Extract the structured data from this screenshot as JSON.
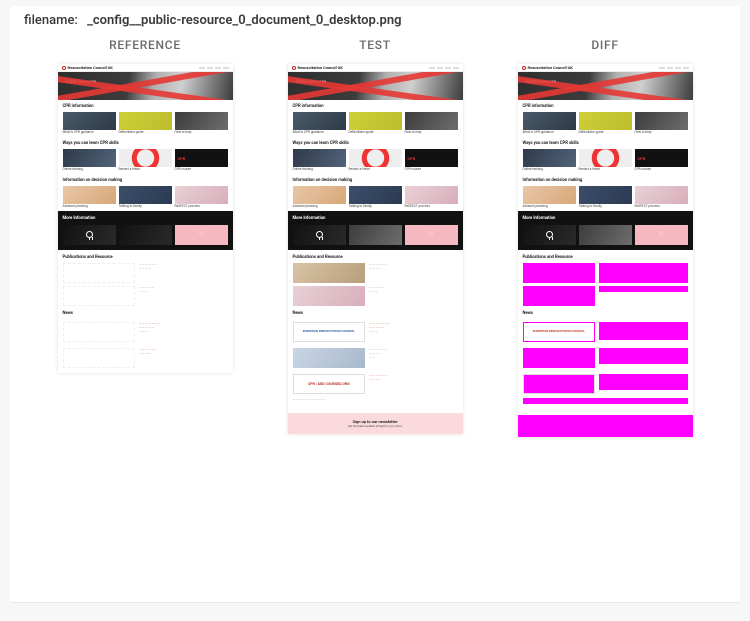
{
  "filename_label": "filename:",
  "filename_value": "_config__public-resource_0_document_0_desktop.png",
  "columns": {
    "reference": "REFERENCE",
    "test": "TEST",
    "diff": "DIFF"
  },
  "page": {
    "brand": "Resuscitation Council UK",
    "hero_title": "Public Resource",
    "sections": {
      "cpr": "CPR information",
      "learn": "Ways you can learn CPR skills",
      "decision": "Information on decision making",
      "more": "More Information",
      "pubs": "Publications and Resource",
      "news": "News"
    },
    "cpr_cards": [
      {
        "caption": "What is CPR guidance"
      },
      {
        "caption": "Defibrillator guide"
      },
      {
        "caption": "How to help"
      }
    ],
    "learn_cards": [
      {
        "caption": "Online training"
      },
      {
        "caption": "Restart a Heart"
      },
      {
        "caption": "CPR course",
        "badge": "CPR"
      }
    ],
    "decision_cards": [
      {
        "caption": "Advance planning"
      },
      {
        "caption": "Talking to family"
      },
      {
        "caption": "ReSPECT process"
      }
    ],
    "partners": {
      "erc": "EUROPEAN RESUSCITATION COUNCIL",
      "cpr_org": "CPR | AED COURSES.ORG"
    },
    "newsletter": {
      "title": "Sign up to our newsletter",
      "subtitle": "Get the latest updates straight to your inbox"
    }
  }
}
